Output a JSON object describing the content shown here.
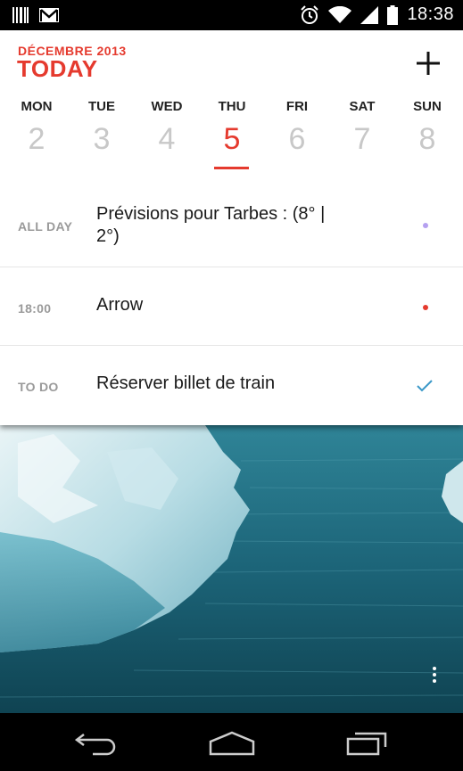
{
  "status_bar": {
    "time": "18:38"
  },
  "header": {
    "month_label": "DÉCEMBRE 2013",
    "today_label": "TODAY",
    "accent_color": "#e53a2e"
  },
  "week": {
    "days": [
      {
        "name": "MON",
        "number": "2"
      },
      {
        "name": "TUE",
        "number": "3"
      },
      {
        "name": "WED",
        "number": "4"
      },
      {
        "name": "THU",
        "number": "5"
      },
      {
        "name": "FRI",
        "number": "6"
      },
      {
        "name": "SAT",
        "number": "7"
      },
      {
        "name": "SUN",
        "number": "8"
      }
    ],
    "selected": "THU"
  },
  "agenda": [
    {
      "label": "ALL DAY",
      "text": "Prévisions pour Tarbes : (8° | 2°)",
      "marker": "dot",
      "marker_color": "#b5a0f0"
    },
    {
      "label": "18:00",
      "text": "Arrow",
      "marker": "dot",
      "marker_color": "#e53a2e"
    },
    {
      "label": "TO DO",
      "text": "Réserver billet de train",
      "marker": "check-icon",
      "marker_color": "#3a98c8"
    }
  ]
}
